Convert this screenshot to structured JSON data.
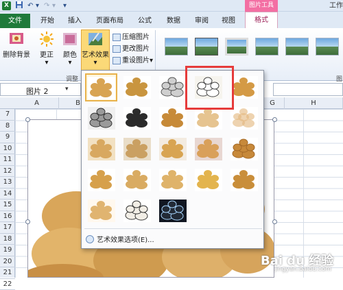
{
  "titlebar": {
    "app_icon": "X",
    "undo_glyph": "↶",
    "redo_glyph": "↷",
    "dropdown_glyph": "▾",
    "context_group": "图片工具",
    "right_label": "工作"
  },
  "tabs": {
    "file": "文件",
    "items": [
      "开始",
      "插入",
      "页面布局",
      "公式",
      "数据",
      "审阅",
      "视图"
    ],
    "format": "格式"
  },
  "ribbon": {
    "remove_background": "删除背景",
    "corrections": "更正",
    "color": "颜色",
    "artistic_effects": "艺术效果",
    "compress": "压缩图片",
    "change": "更改图片",
    "reset": "重设图片",
    "adjust_group_label": "调整",
    "styles_group_label": "图",
    "dropdown_arrow": "▾"
  },
  "namebox": {
    "value": "图片 2",
    "arrow": "▾"
  },
  "columns": [
    "A",
    "B",
    "",
    "",
    "",
    "",
    "G",
    "H"
  ],
  "rows": [
    "7",
    "8",
    "9",
    "10",
    "11",
    "12",
    "13",
    "14",
    "15",
    "16",
    "17",
    "18",
    "19",
    "20",
    "21",
    "22"
  ],
  "gallery": {
    "rows": [
      [
        "none",
        "pencil-sketch",
        "line-drawing",
        "chalk-sketch",
        "paint-strokes"
      ],
      [
        "pencil-grayscale",
        "photocopy",
        "paint-brush",
        "light-screen",
        "blur"
      ],
      [
        "mosaic-bubbles",
        "glass",
        "cement",
        "texturizer",
        "crisscross-etching"
      ],
      [
        "marker",
        "film-grain",
        "pastels-smooth",
        "cutout",
        "plastic-wrap"
      ],
      [
        "glow-diffused",
        "watercolor-sponge",
        "glow-edges"
      ]
    ],
    "options_label": "艺术效果选项(E)...",
    "highlight_color": "#e63b3b"
  },
  "watermark": {
    "text": "Bai du 经验",
    "sub": "jingyan.baidu.com"
  },
  "colors": {
    "file_tab": "#1f7a3a",
    "format_tab": "#9b1c55",
    "context_group": "#f36fa3",
    "selected_cell": "#e8b24b"
  }
}
